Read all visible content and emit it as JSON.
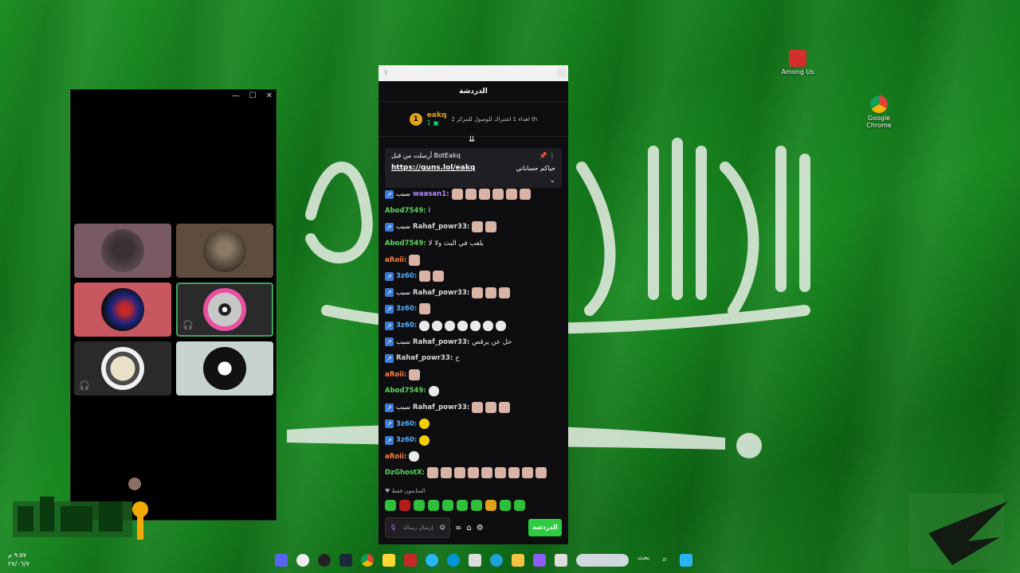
{
  "desktop": {
    "icons": [
      {
        "label": "Among Us",
        "color": "#d32f2f"
      },
      {
        "label": "Google Chrome",
        "color": "#4285f4"
      }
    ]
  },
  "call_window": {
    "controls": [
      "—",
      "☐",
      "✕"
    ],
    "tiles": [
      {
        "bg": "#7a5a62"
      },
      {
        "bg": "#5e4d3e"
      },
      {
        "bg": "#c9575f"
      },
      {
        "bg": "#2a2a2a"
      },
      {
        "bg": "#2a2a2a"
      },
      {
        "bg": "#c8d3d0"
      }
    ]
  },
  "chat": {
    "window_title": "3",
    "title": "الدردشة",
    "leader": {
      "rank": "1",
      "name": "eakq",
      "subs": "1",
      "goal": "اهداء 1 اشتراك للوصول للمركز 2 th"
    },
    "pinned": {
      "by": "أرسلت من قبل BotEakq",
      "link": "https://guns.lol/eakq",
      "text": "حياكم حساباتي"
    },
    "messages": [
      {
        "user": "waasan1:",
        "color": "#b48cff",
        "text": "",
        "badge": true,
        "tag": "سبب",
        "emotes": 6,
        "etype": "em"
      },
      {
        "user": "Abod7549:",
        "color": "#5dd35d",
        "text": "ا",
        "badge": false,
        "tag": "",
        "emotes": 0,
        "etype": "em"
      },
      {
        "user": "Rahaf_powr33:",
        "color": "#d9d9d9",
        "text": "",
        "badge": true,
        "tag": "سبب",
        "emotes": 2,
        "etype": "em"
      },
      {
        "user": "Abod7549:",
        "color": "#5dd35d",
        "text": "يلعب في البث ولا لا",
        "badge": false,
        "tag": "",
        "emotes": 0,
        "etype": "em"
      },
      {
        "user": "aRoii:",
        "color": "#ff7f3f",
        "text": "",
        "badge": false,
        "tag": "",
        "emotes": 1,
        "etype": "em"
      },
      {
        "user": "3z60:",
        "color": "#4fb0ff",
        "text": "",
        "badge": true,
        "tag": "",
        "emotes": 2,
        "etype": "em"
      },
      {
        "user": "Rahaf_powr33:",
        "color": "#d9d9d9",
        "text": "",
        "badge": true,
        "tag": "سبب",
        "emotes": 3,
        "etype": "em"
      },
      {
        "user": "3z60:",
        "color": "#4fb0ff",
        "text": "",
        "badge": true,
        "tag": "",
        "emotes": 1,
        "etype": "em"
      },
      {
        "user": "3z60:",
        "color": "#4fb0ff",
        "text": "",
        "badge": true,
        "tag": "",
        "emotes": 7,
        "etype": "emw"
      },
      {
        "user": "Rahaf_powr33:",
        "color": "#d9d9d9",
        "text": "حل عن يرقص",
        "badge": true,
        "tag": "سبب",
        "emotes": 0,
        "etype": "em"
      },
      {
        "user": "Rahaf_powr33:",
        "color": "#d9d9d9",
        "text": "ح",
        "badge": true,
        "tag": "",
        "emotes": 0,
        "etype": "em"
      },
      {
        "user": "aRoii:",
        "color": "#ff7f3f",
        "text": "",
        "badge": false,
        "tag": "",
        "emotes": 1,
        "etype": "em"
      },
      {
        "user": "Abod7549:",
        "color": "#5dd35d",
        "text": "",
        "badge": false,
        "tag": "",
        "emotes": 1,
        "etype": "emw"
      },
      {
        "user": "Rahaf_powr33:",
        "color": "#d9d9d9",
        "text": "",
        "badge": true,
        "tag": "سبب",
        "emotes": 3,
        "etype": "em"
      },
      {
        "user": "3z60:",
        "color": "#4fb0ff",
        "text": "",
        "badge": true,
        "tag": "",
        "emotes": 1,
        "etype": "emy"
      },
      {
        "user": "3z60:",
        "color": "#4fb0ff",
        "text": "",
        "badge": true,
        "tag": "",
        "emotes": 1,
        "etype": "emy"
      },
      {
        "user": "aRoii:",
        "color": "#ff7f3f",
        "text": "",
        "badge": false,
        "tag": "",
        "emotes": 1,
        "etype": "emw"
      },
      {
        "user": "DzGhostX:",
        "color": "#5dd35d",
        "text": "",
        "badge": false,
        "tag": "",
        "emotes": 9,
        "etype": "em"
      }
    ],
    "viewers_label": "المتابعون فقط",
    "input_placeholder": "إرسال رسالة",
    "send_label": "الدردشة"
  },
  "taskbar": {
    "search_label": "بحث"
  },
  "clock": {
    "time": "٩:٥٧ م",
    "date": "٢٧/٠٦/٧"
  }
}
